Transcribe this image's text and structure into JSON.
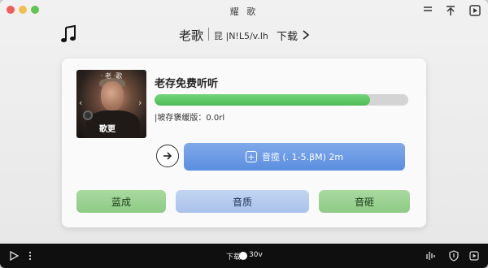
{
  "window": {
    "title": "耀 歌"
  },
  "header": {
    "title": "老歌",
    "subtitle": "昆 |N!L5/v.lh",
    "download_label": "下载"
  },
  "card": {
    "cover": {
      "top_label": "· 老 ·歌",
      "label": "歌更"
    },
    "song_title": "老存免费听听",
    "progress": 0.85,
    "cache_text": "|坡存褒缓版：0.0rl",
    "quality_text": "音揽 (.  1-5.βM) 2m"
  },
  "buttons": {
    "left": "蓝成",
    "middle": "音质",
    "right": "音砸"
  },
  "bottombar": {
    "left_text": "下载",
    "right_text": "30v"
  },
  "colors": {
    "progress_green": "#4cba55",
    "accent_blue": "#5b8ee0",
    "button_green": "#8ecb85"
  }
}
